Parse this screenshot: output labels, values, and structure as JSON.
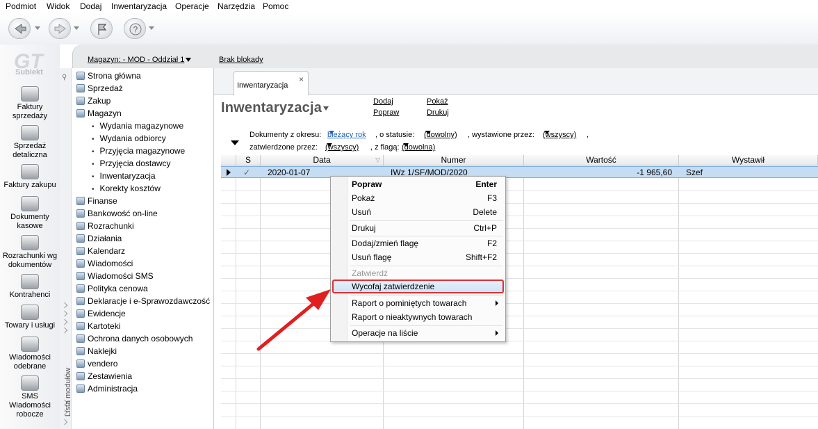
{
  "menubar": {
    "items": [
      "Podmiot",
      "Widok",
      "Dodaj",
      "Inwentaryzacja",
      "Operacje",
      "Narzędzia",
      "Pomoc"
    ]
  },
  "logo": {
    "text": "Subiekt"
  },
  "leftnav": {
    "items": [
      {
        "label1": "Faktury",
        "label2": "sprzedaży",
        "icon": "invoice-sales-icon"
      },
      {
        "label1": "Sprzedaż",
        "label2": "detaliczna",
        "icon": "retail-icon"
      },
      {
        "label1": "Faktury zakupu",
        "label2": "",
        "icon": "invoice-purchase-icon"
      },
      {
        "label1": "Dokumenty",
        "label2": "kasowe",
        "icon": "cash-documents-icon"
      },
      {
        "label1": "Rozrachunki wg",
        "label2": "dokumentów",
        "icon": "settlements-icon"
      },
      {
        "label1": "Kontrahenci",
        "label2": "",
        "icon": "contractors-icon"
      },
      {
        "label1": "Towary i usługi",
        "label2": "",
        "icon": "goods-icon"
      },
      {
        "label1": "Wiadomości",
        "label2": "odebrane",
        "icon": "messages-icon"
      },
      {
        "label1": "SMS",
        "label2": "Wiadomości",
        "label3": "robocze",
        "icon": "sms-icon"
      }
    ]
  },
  "header": {
    "warehouse": "Magazyn: - MOD - Oddział 1",
    "lock": "Brak blokady"
  },
  "sidebar": {
    "strip_label": "Lista modułów",
    "modules": [
      {
        "label": "Strona główna"
      },
      {
        "label": "Sprzedaż"
      },
      {
        "label": "Zakup"
      },
      {
        "label": "Magazyn"
      }
    ],
    "submodules": [
      "Wydania magazynowe",
      "Wydania odbiorcy",
      "Przyjęcia magazynowe",
      "Przyjęcia dostawcy",
      "Inwentaryzacja",
      "Korekty kosztów"
    ],
    "modules2": [
      "Finanse",
      "Bankowość on-line",
      "Rozrachunki",
      "Działania",
      "Kalendarz",
      "Wiadomości",
      "Wiadomości SMS",
      "Polityka cenowa",
      "Deklaracje i e-Sprawozdawczość",
      "Ewidencje",
      "Kartoteki",
      "Ochrona danych osobowych",
      "Naklejki",
      "vendero",
      "Zestawienia",
      "Administracja"
    ]
  },
  "tab": {
    "label": "Inwentaryzacja",
    "close": "×"
  },
  "page": {
    "title": "Inwentaryzacja",
    "actions": {
      "add": "Dodaj",
      "edit": "Popraw",
      "show": "Pokaż",
      "print": "Drukuj"
    }
  },
  "filter": {
    "period_label": "Dokumenty z okresu:",
    "period_value": "bieżący rok",
    "status_label": ", o statusie:",
    "status_value": "(dowolny)",
    "issued_label": ", wystawione przez:",
    "issued_value": "(wszyscy)",
    "approved_label": "zatwierdzone przez:",
    "approved_value": "(wszyscy)",
    "flag_label": ", z flagą:",
    "flag_value": "(dowolna)"
  },
  "grid": {
    "columns": [
      "S",
      "Data",
      "Numer",
      "Wartość",
      "Wystawił"
    ],
    "rows": [
      {
        "date": "2020-01-07",
        "number": "IWz 1/SF/MOD/2020",
        "value": "-1 965,60",
        "issuer": "Szef"
      }
    ]
  },
  "context_menu": {
    "items": [
      {
        "label": "Popraw",
        "shortcut": "Enter"
      },
      {
        "label": "Pokaż",
        "shortcut": "F3"
      },
      {
        "label": "Usuń",
        "shortcut": "Delete"
      },
      {
        "label": "Drukuj",
        "shortcut": "Ctrl+P"
      },
      {
        "label": "Dodaj/zmień flagę",
        "shortcut": "F2"
      },
      {
        "label": "Usuń flagę",
        "shortcut": "Shift+F2"
      },
      {
        "label": "Zatwierdź",
        "shortcut": ""
      },
      {
        "label": "Wycofaj zatwierdzenie",
        "shortcut": ""
      },
      {
        "label": "Raport o pominiętych towarach",
        "shortcut": ""
      },
      {
        "label": "Raport o nieaktywnych towarach",
        "shortcut": ""
      },
      {
        "label": "Operacje na liście",
        "shortcut": ""
      }
    ]
  },
  "colors": {
    "selection": "#c5dcf3",
    "highlight_border": "#e03030",
    "arrow": "#e02020"
  }
}
